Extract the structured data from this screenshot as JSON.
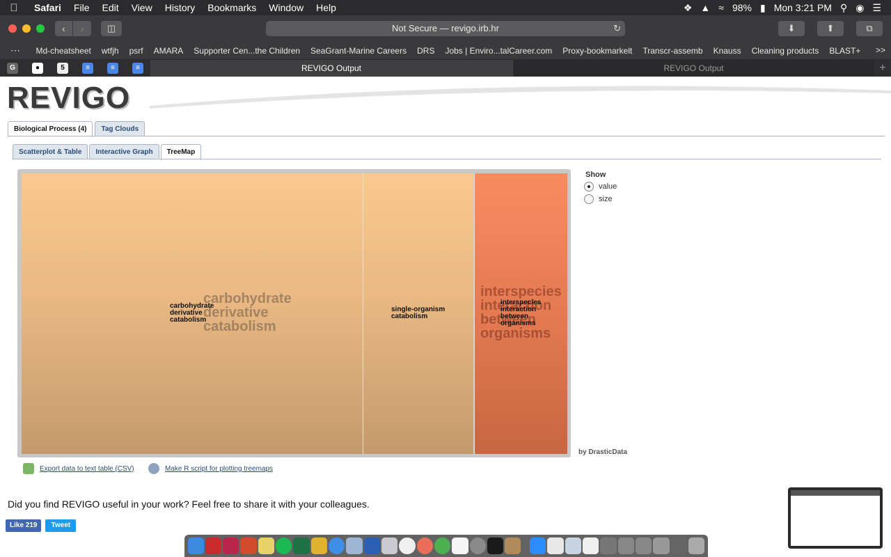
{
  "menubar": {
    "app": "Safari",
    "items": [
      "File",
      "Edit",
      "View",
      "History",
      "Bookmarks",
      "Window",
      "Help"
    ],
    "battery": "98%",
    "clock": "Mon 3:21 PM"
  },
  "toolbar": {
    "url": "Not Secure — revigo.irb.hr"
  },
  "bookmarks": [
    "Md-cheatsheet",
    "wtfjh",
    "psrf",
    "AMARA",
    "Supporter Cen...the Children",
    "SeaGrant-Marine Careers",
    "DRS",
    "Jobs | Enviro...talCareer.com",
    "Proxy-bookmarkelt",
    "Transcr-assemb",
    "Knauss",
    "Cleaning products",
    "BLAST+"
  ],
  "bookmarks_more": ">>",
  "tabs": {
    "active": "REVIGO Output",
    "inactive": "REVIGO Output"
  },
  "page": {
    "logo": "REVIGO",
    "top_tabs": [
      "Biological Process (4)",
      "Tag Clouds"
    ],
    "sub_tabs": [
      "Scatterplot & Table",
      "Interactive Graph",
      "TreeMap"
    ],
    "treemap": {
      "cells": [
        {
          "big_label": [
            "carbohydrate",
            "derivative",
            "catabolism"
          ],
          "small_label": [
            "carbohydrate",
            "derivative",
            "catabolism"
          ]
        },
        {
          "small_label": [
            "single-organism",
            "catabolism"
          ]
        },
        {
          "big_label": [
            "interspecies",
            "interaction",
            "between",
            "organisms"
          ],
          "small_label": [
            "interspecies",
            "interaction",
            "between",
            "organisms"
          ]
        }
      ]
    },
    "show": {
      "title": "Show",
      "options": [
        "value",
        "size"
      ],
      "selected": "value"
    },
    "credit": "by DrasticData",
    "export_csv": "Export data to text table (CSV)",
    "make_r": "Make R script for plotting treemaps",
    "share_text": "Did you find REVIGO useful in your work? Feel free to share it with your colleagues.",
    "fb_label": "Like 219",
    "tweet_label": "Tweet"
  }
}
